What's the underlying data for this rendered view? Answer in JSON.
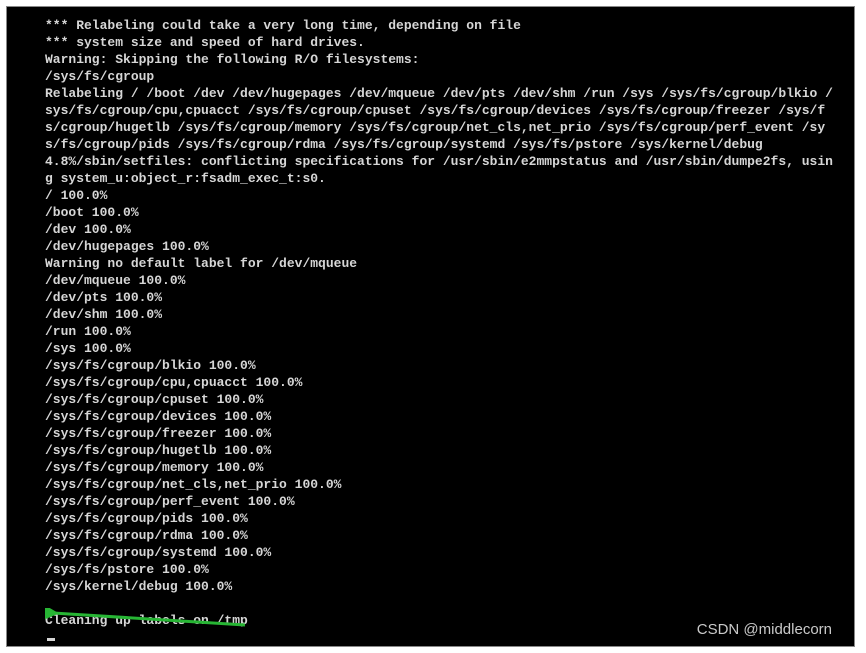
{
  "terminal": {
    "lines": [
      "*** Relabeling could take a very long time, depending on file",
      "*** system size and speed of hard drives.",
      "Warning: Skipping the following R/O filesystems:",
      "/sys/fs/cgroup",
      "Relabeling / /boot /dev /dev/hugepages /dev/mqueue /dev/pts /dev/shm /run /sys /sys/fs/cgroup/blkio /sys/fs/cgroup/cpu,cpuacct /sys/fs/cgroup/cpuset /sys/fs/cgroup/devices /sys/fs/cgroup/freezer /sys/fs/cgroup/hugetlb /sys/fs/cgroup/memory /sys/fs/cgroup/net_cls,net_prio /sys/fs/cgroup/perf_event /sys/fs/cgroup/pids /sys/fs/cgroup/rdma /sys/fs/cgroup/systemd /sys/fs/pstore /sys/kernel/debug",
      "4.8%/sbin/setfiles: conflicting specifications for /usr/sbin/e2mmpstatus and /usr/sbin/dumpe2fs, using system_u:object_r:fsadm_exec_t:s0.",
      "/ 100.0%",
      "/boot 100.0%",
      "/dev 100.0%",
      "/dev/hugepages 100.0%",
      "Warning no default label for /dev/mqueue",
      "/dev/mqueue 100.0%",
      "/dev/pts 100.0%",
      "/dev/shm 100.0%",
      "/run 100.0%",
      "/sys 100.0%",
      "/sys/fs/cgroup/blkio 100.0%",
      "/sys/fs/cgroup/cpu,cpuacct 100.0%",
      "/sys/fs/cgroup/cpuset 100.0%",
      "/sys/fs/cgroup/devices 100.0%",
      "/sys/fs/cgroup/freezer 100.0%",
      "/sys/fs/cgroup/hugetlb 100.0%",
      "/sys/fs/cgroup/memory 100.0%",
      "/sys/fs/cgroup/net_cls,net_prio 100.0%",
      "/sys/fs/cgroup/perf_event 100.0%",
      "/sys/fs/cgroup/pids 100.0%",
      "/sys/fs/cgroup/rdma 100.0%",
      "/sys/fs/cgroup/systemd 100.0%",
      "/sys/fs/pstore 100.0%",
      "/sys/kernel/debug 100.0%",
      "",
      "Cleaning up labels on /tmp"
    ]
  },
  "watermark": "CSDN @middlecorn",
  "colors": {
    "bg": "#000000",
    "fg": "#d6d6d6",
    "arrow": "#27b534"
  }
}
